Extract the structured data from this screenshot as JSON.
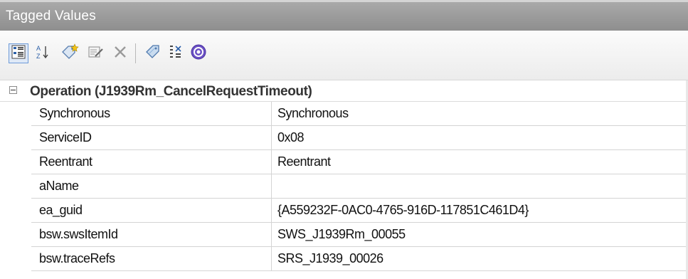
{
  "panel": {
    "title": "Tagged Values"
  },
  "toolbar": {
    "buttons": [
      {
        "name": "categorized-view",
        "icon": "categorized-grid-icon",
        "active": true
      },
      {
        "name": "alphabetical-sort",
        "icon": "sort-az-icon",
        "active": false
      },
      {
        "name": "new-tag",
        "icon": "new-tag-icon",
        "active": false
      },
      {
        "name": "edit-note",
        "icon": "edit-note-icon",
        "active": false
      },
      {
        "name": "delete-tag",
        "icon": "delete-icon",
        "active": false
      },
      {
        "name": "tag-filter",
        "icon": "tag-icon",
        "active": false
      },
      {
        "name": "expand-collapse",
        "icon": "tree-expand-icon",
        "active": false
      },
      {
        "name": "help",
        "icon": "help-icon",
        "active": false
      }
    ]
  },
  "grid": {
    "category": {
      "label": "Operation (J1939Rm_CancelRequestTimeout)",
      "expanded": true
    },
    "rows": [
      {
        "name": "Synchronous",
        "value": "Synchronous"
      },
      {
        "name": "ServiceID",
        "value": "0x08"
      },
      {
        "name": "Reentrant",
        "value": "Reentrant"
      },
      {
        "name": "aName",
        "value": ""
      },
      {
        "name": "ea_guid",
        "value": "{A559232F-0AC0-4765-916D-117851C461D4}"
      },
      {
        "name": "bsw.swsItemId",
        "value": "SWS_J1939Rm_00055"
      },
      {
        "name": "bsw.traceRefs",
        "value": "SRS_J1939_00026"
      }
    ]
  },
  "colors": {
    "titlebar": "#9a9a9a",
    "title_text": "#ffffff",
    "grid_line": "#d4d4d4",
    "active_button_border": "#6e9bd8"
  }
}
